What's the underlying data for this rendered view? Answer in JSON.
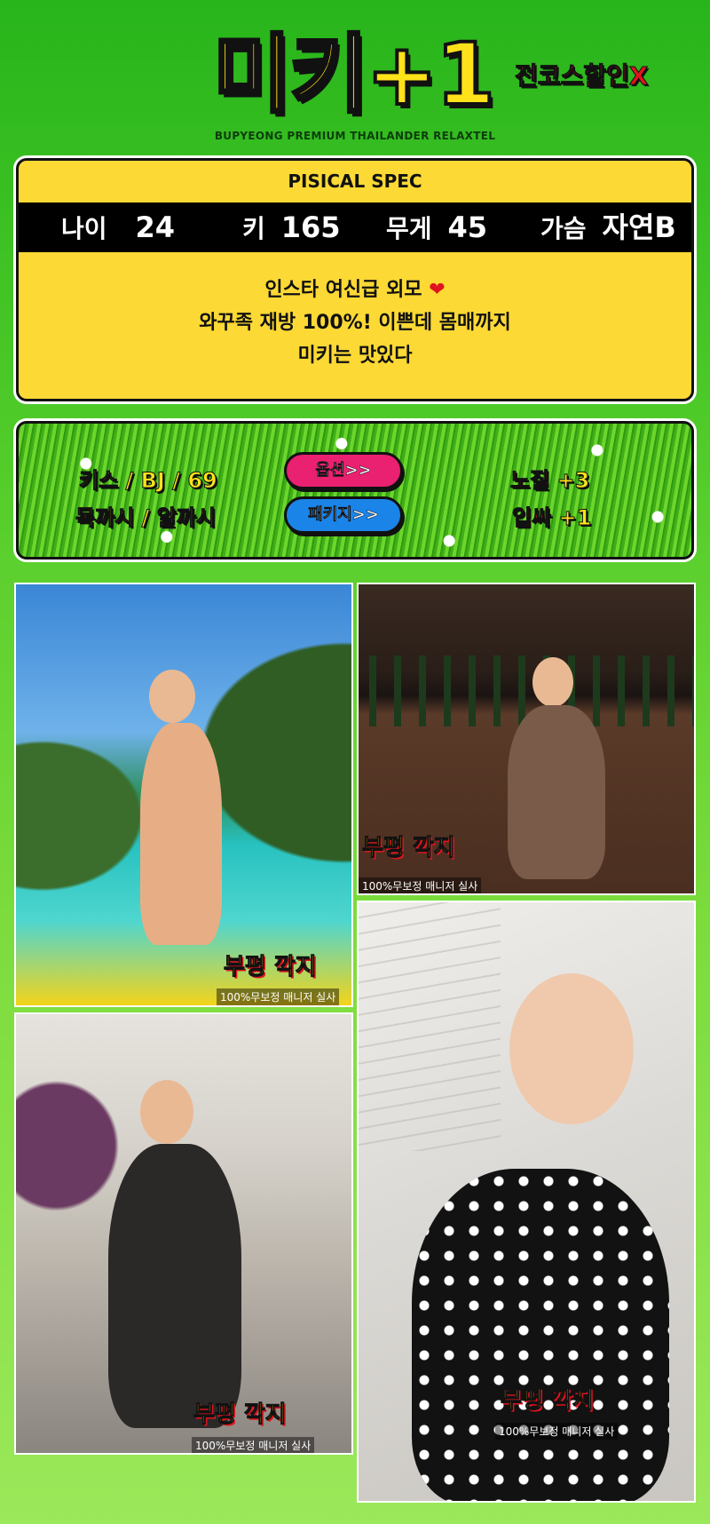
{
  "header": {
    "logo": "미키+1",
    "promo": "전코스할인X",
    "tagline": "BUPYEONG PREMIUM THAILANDER RELAXTEL"
  },
  "spec": {
    "title": "PISICAL SPEC",
    "items": [
      {
        "label": "나이",
        "value": "24"
      },
      {
        "label": "키",
        "value": "165"
      },
      {
        "label": "무게",
        "value": "45"
      },
      {
        "label": "가슴",
        "value": "자연B"
      }
    ],
    "desc": [
      "인스타 여신급 외모",
      "와꾸족 재방 100%! 이쁜데 몸매까지",
      "미키는 맛있다"
    ]
  },
  "services": {
    "left_line1": "키스 / BJ / 69",
    "left_line2": "목까시 / 알까시",
    "option_button": "옵션>>",
    "package_button": "패키지>>",
    "right_line1_label": "노질",
    "right_line1_value": "+3",
    "right_line2_label": "입싸",
    "right_line2_value": "+1"
  },
  "watermark": {
    "title": "부평 깍지",
    "sub": "100%무보정 매니저 실사"
  },
  "colors": {
    "background_green": "#27b51b",
    "spec_yellow": "#fcd935",
    "accent_red": "#e0141e",
    "pill_pink": "#ea2070",
    "pill_blue": "#1b84e8"
  }
}
